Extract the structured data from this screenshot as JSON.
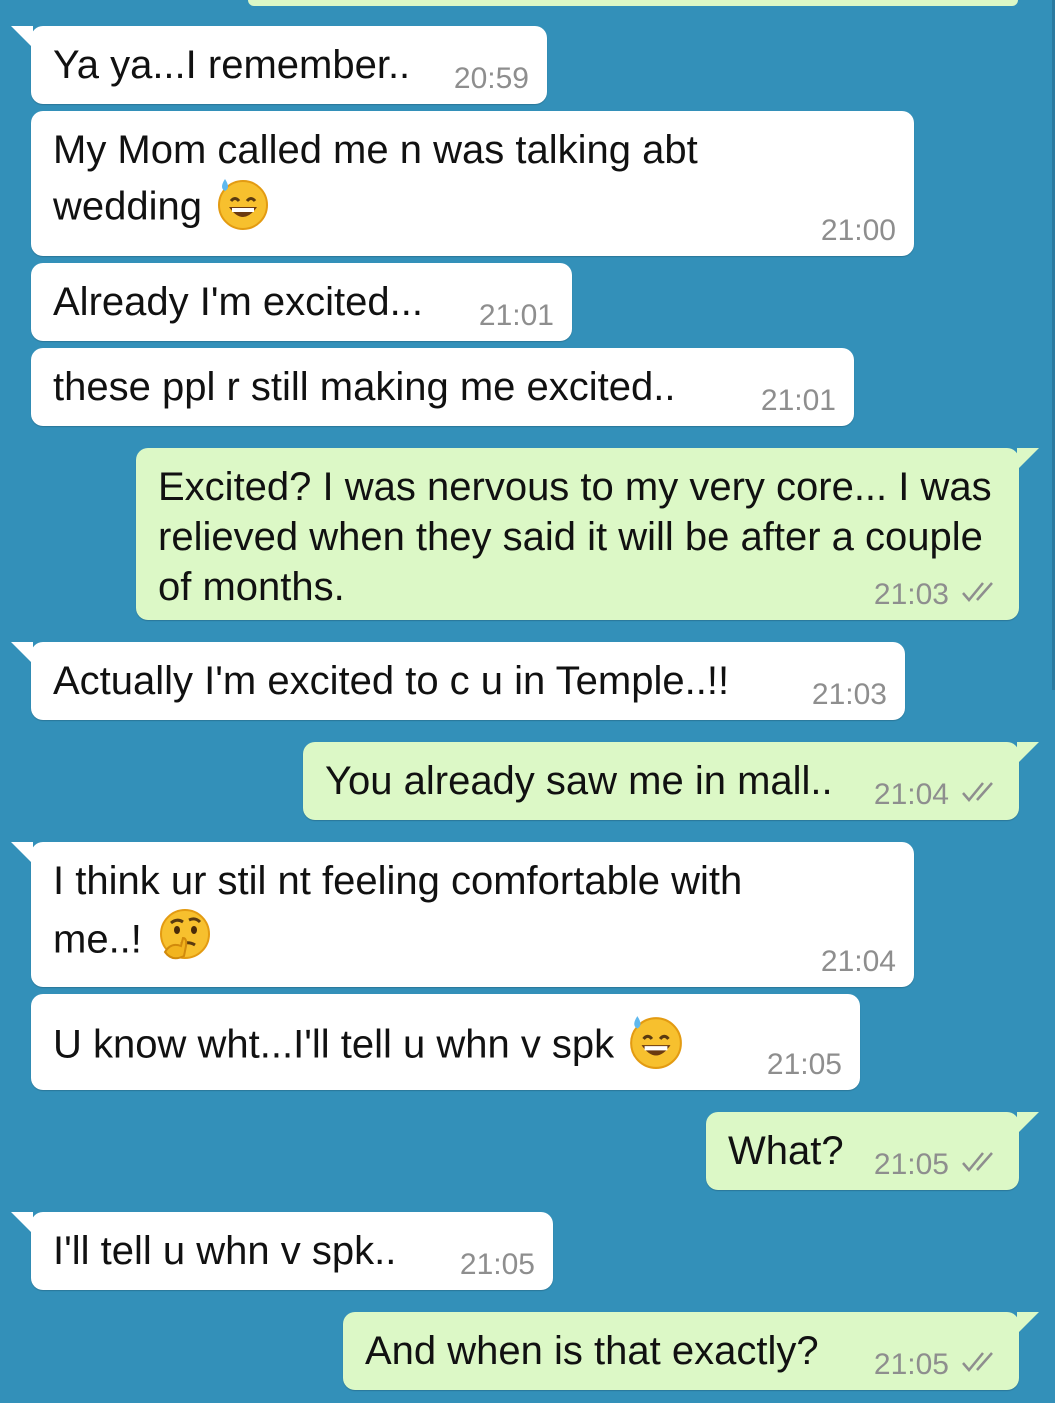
{
  "colors": {
    "background": "#3390b9",
    "incoming_bubble": "#ffffff",
    "outgoing_bubble": "#dcf8c6",
    "timestamp": "#8e8e8e",
    "read_ticks": "#8e8e8e"
  },
  "messages": [
    {
      "dir": "in",
      "text": "Ya ya...I remember..",
      "time": "20:59"
    },
    {
      "dir": "in",
      "text": "My Mom called me n was talking abt wedding",
      "emoji": "sweat-smile-icon",
      "time": "21:00"
    },
    {
      "dir": "in",
      "text": "Already I'm excited...",
      "time": "21:01"
    },
    {
      "dir": "in",
      "text": "these ppl r still making me excited..",
      "time": "21:01"
    },
    {
      "dir": "out",
      "text": "Excited? I was nervous to my very core... I was relieved when they said it will be after a couple of months.",
      "time": "21:03",
      "status": "double-check-icon"
    },
    {
      "dir": "in",
      "text": "Actually I'm excited to c u in Temple..!!",
      "time": "21:03"
    },
    {
      "dir": "out",
      "text": "You already saw me in mall..",
      "time": "21:04",
      "status": "double-check-icon"
    },
    {
      "dir": "in",
      "text": "I think ur stil nt feeling comfortable with me..!",
      "emoji": "thinking-face-icon",
      "time": "21:04"
    },
    {
      "dir": "in",
      "text": "U know wht...I'll tell u whn v spk",
      "emoji": "sweat-smile-icon",
      "time": "21:05"
    },
    {
      "dir": "out",
      "text": "What?",
      "time": "21:05",
      "status": "double-check-icon"
    },
    {
      "dir": "in",
      "text": "I'll tell u whn v spk..",
      "time": "21:05"
    },
    {
      "dir": "out",
      "text": "And when is that exactly?",
      "time": "21:05",
      "status": "double-check-icon"
    }
  ]
}
